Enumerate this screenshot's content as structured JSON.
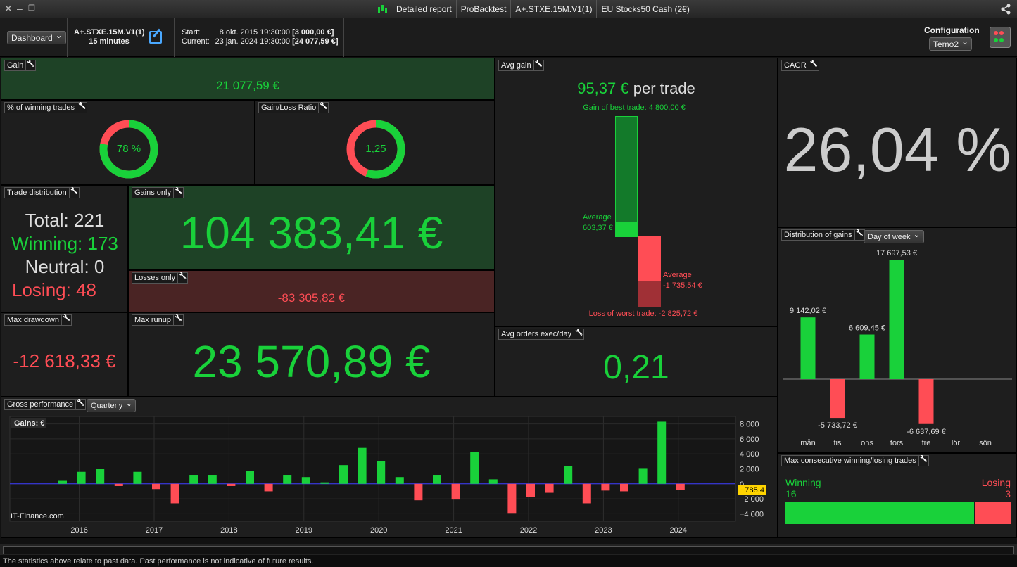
{
  "topbar": {
    "tabs": [
      "Detailed report",
      "ProBacktest",
      "A+.STXE.15M.V1(1)",
      "EU Stocks50 Cash (2€)"
    ]
  },
  "header": {
    "dashboard_select": "Dashboard",
    "system_name": "A+.STXE.15M.V1(1)",
    "timeframe": "15 minutes",
    "start_label": "Start:",
    "start_date": "8 okt. 2015 19:30:00",
    "start_value": "[3 000,00 €]",
    "current_label": "Current:",
    "current_date": "23 jan. 2024 19:30:00",
    "current_value": "[24 077,59 €]",
    "config_label": "Configuration",
    "config_select": "Temo2"
  },
  "panels": {
    "gain": {
      "title": "Gain",
      "value": "21 077,59 €"
    },
    "winning_pct": {
      "title": "% of winning trades",
      "value": "78 %",
      "fraction": 0.78
    },
    "gain_loss": {
      "title": "Gain/Loss Ratio",
      "value": "1,25",
      "fraction": 0.556
    },
    "avg_gain": {
      "title": "Avg gain",
      "value": "95,37 €",
      "suffix": "per trade",
      "best_label": "Gain of best trade: 4 800,00 €",
      "worst_label": "Loss of worst trade: -2 825,72 €",
      "avg_win_label": "Average",
      "avg_win_value": "603,37 €",
      "avg_loss_label": "Average",
      "avg_loss_value": "-1 735,54 €"
    },
    "cagr": {
      "title": "CAGR",
      "value": "26,04 %"
    },
    "trade_distribution": {
      "title": "Trade distribution",
      "total": "Total: 221",
      "winning": "Winning: 173",
      "neutral": "Neutral: 0",
      "losing": "Losing: 48"
    },
    "gains_only": {
      "title": "Gains only",
      "value": "104 383,41 €"
    },
    "losses_only": {
      "title": "Losses only",
      "value": "-83 305,82 €"
    },
    "max_drawdown": {
      "title": "Max drawdown",
      "value": "-12 618,33 €"
    },
    "max_runup": {
      "title": "Max runup",
      "value": "23 570,89 €"
    },
    "avg_orders": {
      "title": "Avg orders exec/day",
      "value": "0,21"
    },
    "distribution": {
      "title": "Distribution of gains",
      "select": "Day of week"
    },
    "gross": {
      "title": "Gross performance",
      "select": "Quarterly",
      "legend": "Gains: €",
      "watermark": "IT-Finance.com",
      "current_value": "-785,4"
    },
    "consecutive": {
      "title": "Max consecutive winning/losing trades",
      "win_label": "Winning",
      "win_value": "16",
      "lose_label": "Losing",
      "lose_value": "3"
    }
  },
  "footer": {
    "disclaimer": "The statistics above relate to past data. Past performance is not indicative of future results."
  },
  "colors": {
    "green": "#19d13a",
    "red": "#ff4d55",
    "panel": "#1e1e1e",
    "green_bg": "#1e4226",
    "red_bg": "#4a2424"
  },
  "chart_data": [
    {
      "type": "bar",
      "title": "Distribution of gains",
      "categories": [
        "mån",
        "tis",
        "ons",
        "tors",
        "fre",
        "lör",
        "sön"
      ],
      "values": [
        9142.02,
        -5733.72,
        6609.45,
        17697.53,
        -6637.69,
        0,
        0
      ],
      "labels": [
        "9 142,02 €",
        "-5 733,72 €",
        "6 609,45 €",
        "17 697,53 €",
        "-6 637,69 €",
        "",
        ""
      ]
    },
    {
      "type": "bar",
      "title": "Gross performance",
      "ylabel": "Gains: €",
      "ylim": [
        -5000,
        9000
      ],
      "yticks": [
        -4000,
        -2000,
        0,
        2000,
        4000,
        6000,
        8000
      ],
      "ytick_labels": [
        "−4 000",
        "−2 000",
        "0",
        "2 000",
        "4 000",
        "6 000",
        "8 000"
      ],
      "xtick_labels": [
        "2016",
        "2017",
        "2018",
        "2019",
        "2020",
        "2021",
        "2022",
        "2023",
        "2024"
      ],
      "x": [
        "2015Q4",
        "2016Q1",
        "2016Q2",
        "2016Q3",
        "2016Q4",
        "2017Q1",
        "2017Q2",
        "2017Q3",
        "2017Q4",
        "2018Q1",
        "2018Q2",
        "2018Q3",
        "2018Q4",
        "2019Q1",
        "2019Q2",
        "2019Q3",
        "2019Q4",
        "2020Q1",
        "2020Q2",
        "2020Q3",
        "2020Q4",
        "2021Q1",
        "2021Q2",
        "2021Q3",
        "2021Q4",
        "2022Q1",
        "2022Q2",
        "2022Q3",
        "2022Q4",
        "2023Q1",
        "2023Q2",
        "2023Q3",
        "2023Q4",
        "2024Q1"
      ],
      "values": [
        400,
        1600,
        2000,
        -300,
        1600,
        -700,
        -2600,
        1200,
        1200,
        -300,
        1700,
        -1000,
        1200,
        900,
        200,
        2500,
        4800,
        3000,
        900,
        -2200,
        1200,
        -2100,
        4300,
        600,
        -3900,
        -1800,
        -1200,
        2400,
        -2600,
        -900,
        -1000,
        2100,
        8300,
        -800
      ]
    }
  ]
}
